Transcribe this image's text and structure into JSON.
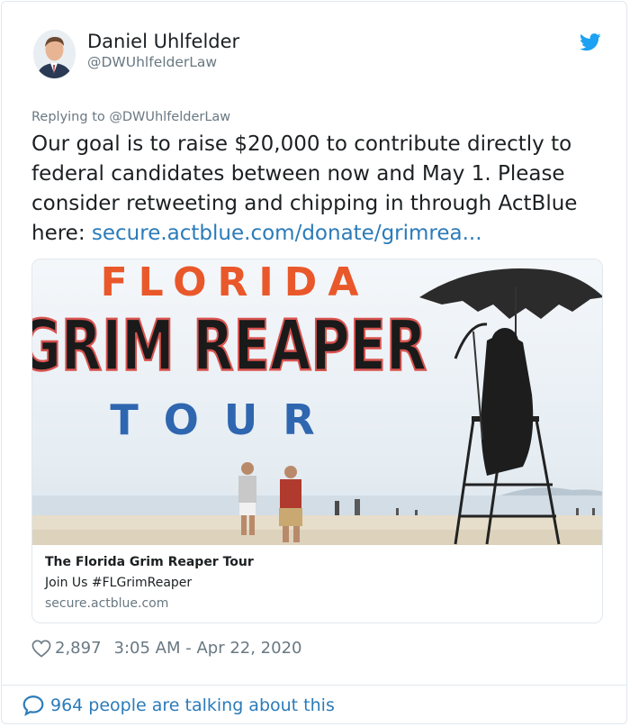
{
  "tweet": {
    "author_name": "Daniel Uhlfelder",
    "author_handle": "@DWUhlfelderLaw",
    "replying_to": "Replying to @DWUhlfelderLaw",
    "text_before_link": "Our goal is to raise $20,000 to contribute directly to federal candidates between now and May 1. Please consider retweeting and chipping in through ActBlue here: ",
    "link_text": "secure.actblue.com/donate/grimrea...",
    "likes": "2,897",
    "timestamp": "3:05 AM - Apr 22, 2020",
    "talking": "964 people are talking about this"
  },
  "card": {
    "image_line1": "FLORIDA",
    "image_line2": "GRIM REAPER",
    "image_line3": "T O U R",
    "title": "The Florida Grim Reaper Tour",
    "description": "Join Us #FLGrimReaper",
    "domain": "secure.actblue.com"
  },
  "colors": {
    "link": "#2b7bb9",
    "twitter_blue": "#1da1f2",
    "orange": "#e9582a",
    "tour_blue": "#2f66b0"
  },
  "icons": [
    "twitter-bird-icon",
    "heart-icon",
    "speech-bubble-icon"
  ]
}
